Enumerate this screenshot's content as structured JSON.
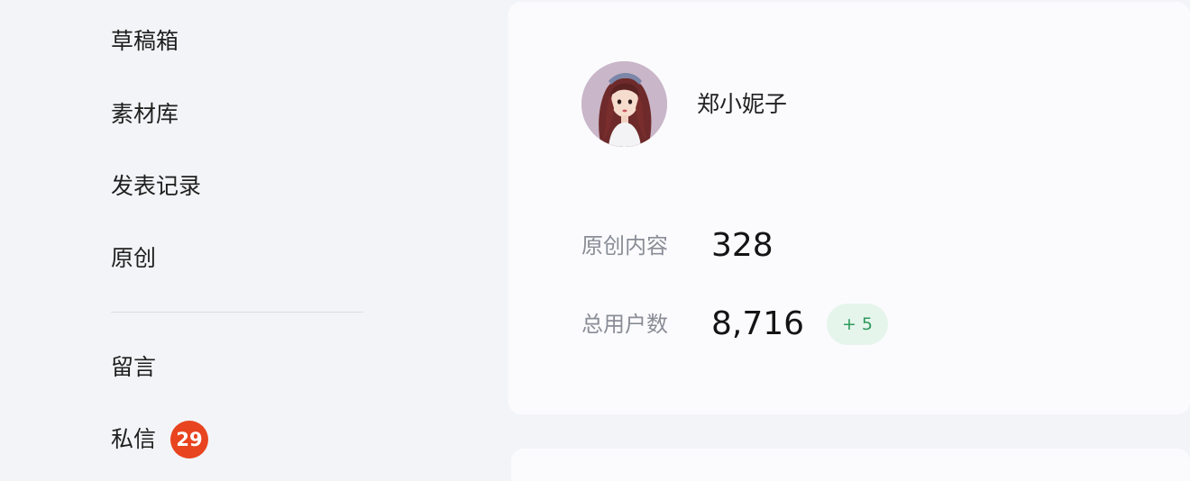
{
  "sidebar": {
    "items": [
      {
        "label": "草稿箱"
      },
      {
        "label": "素材库"
      },
      {
        "label": "发表记录"
      },
      {
        "label": "原创"
      },
      {
        "label": "留言"
      },
      {
        "label": "私信",
        "badge": "29"
      }
    ]
  },
  "profile": {
    "username": "郑小妮子",
    "avatar_icon": "user-avatar"
  },
  "stats": {
    "original_content_label": "原创内容",
    "original_content_value": "328",
    "total_users_label": "总用户数",
    "total_users_value": "8,716",
    "total_users_delta": "+ 5"
  },
  "colors": {
    "badge": "#e8441f",
    "delta_bg": "#e6f5ec",
    "delta_text": "#2e9a5b"
  }
}
